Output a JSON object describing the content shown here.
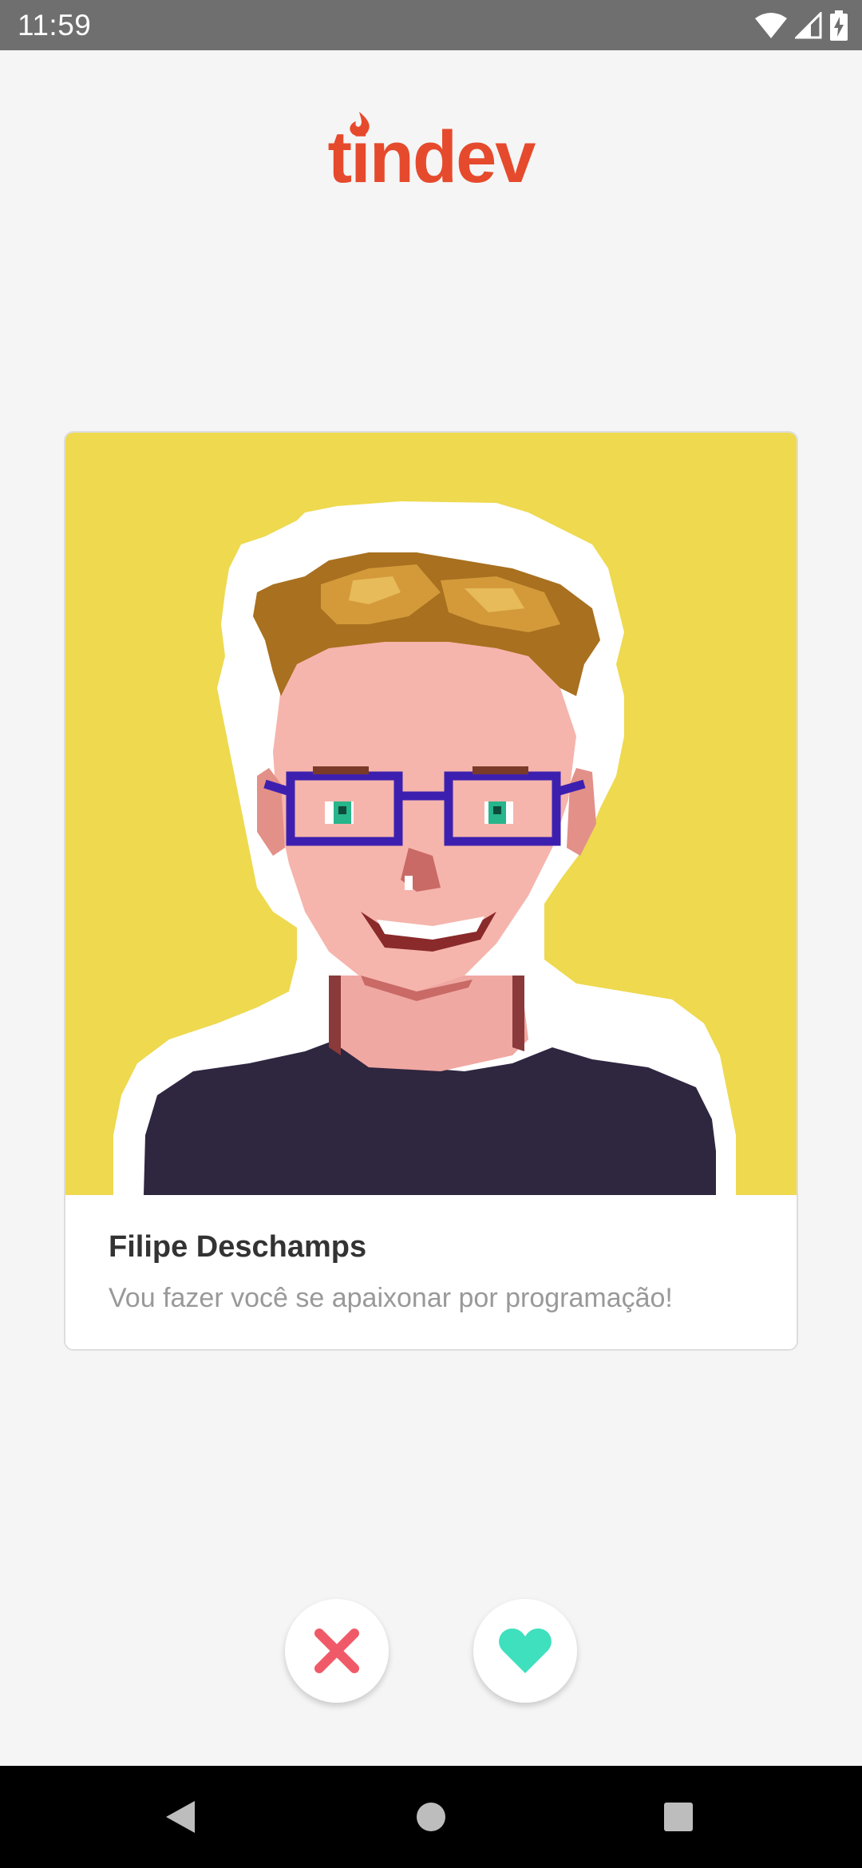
{
  "status_bar": {
    "time": "11:59",
    "icons": [
      "wifi-icon",
      "cell-signal-icon",
      "battery-charging-icon"
    ]
  },
  "app": {
    "logo_text": "tindev",
    "brand_color": "#e64a2d"
  },
  "profile": {
    "name": "Filipe Deschamps",
    "bio": "Vou fazer você se apaixonar por programação!",
    "avatar_background": "#eed94f"
  },
  "actions": {
    "dislike_icon": "close-icon",
    "dislike_color": "#f05a68",
    "like_icon": "heart-icon",
    "like_color": "#3ee0bd"
  },
  "nav_bar": {
    "buttons": [
      "back-icon",
      "home-icon",
      "recent-apps-icon"
    ]
  }
}
